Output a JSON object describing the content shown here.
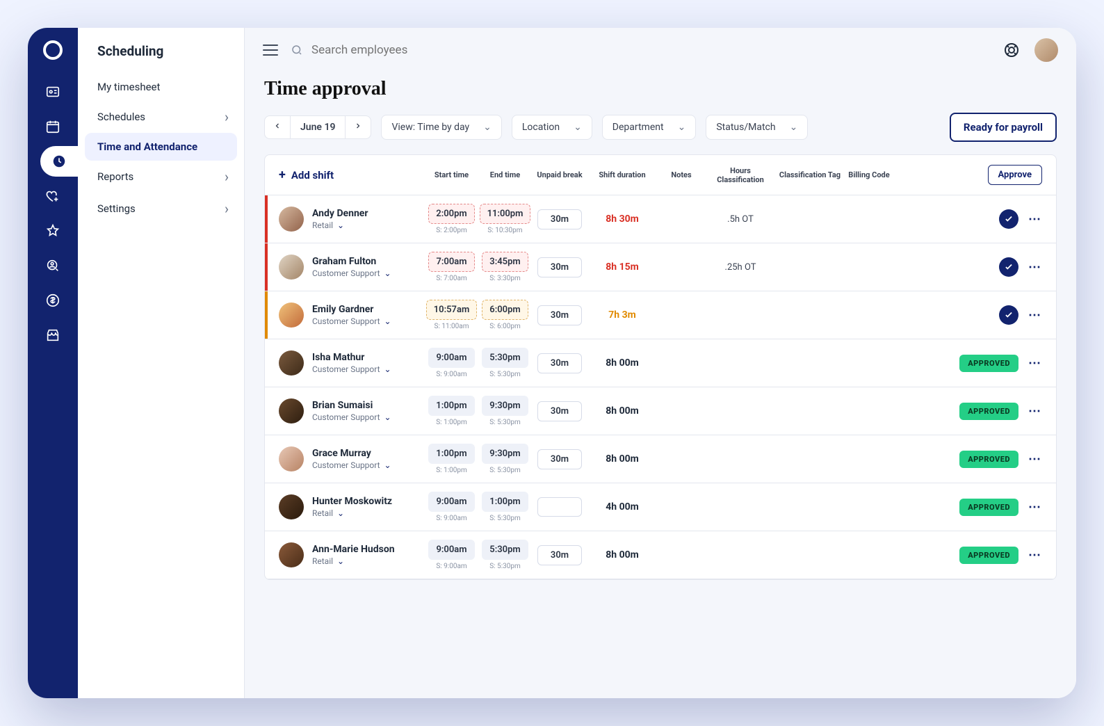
{
  "sidebar": {
    "title": "Scheduling",
    "items": [
      {
        "label": "My timesheet",
        "expandable": false
      },
      {
        "label": "Schedules",
        "expandable": true
      },
      {
        "label": "Time and Attendance",
        "expandable": false,
        "active": true
      },
      {
        "label": "Reports",
        "expandable": true
      },
      {
        "label": "Settings",
        "expandable": true
      }
    ]
  },
  "search": {
    "placeholder": "Search employees"
  },
  "page": {
    "title": "Time approval",
    "date": "June 19",
    "filters": {
      "view": "View: Time by day",
      "location": "Location",
      "department": "Department",
      "status": "Status/Match"
    },
    "payroll_btn": "Ready for payroll"
  },
  "table": {
    "add_shift_label": "Add shift",
    "headers": {
      "start": "Start time",
      "end": "End time",
      "break": "Unpaid break",
      "duration": "Shift duration",
      "notes": "Notes",
      "hours_class": "Hours Classification",
      "class_tag": "Classification Tag",
      "bill": "Billing Code",
      "approve": "Approve"
    },
    "rows": [
      {
        "name": "Andy Denner",
        "dept": "Retail",
        "start": "2:00pm",
        "start_sched": "S: 2:00pm",
        "end": "11:00pm",
        "end_sched": "S: 10:30pm",
        "break": "30m",
        "duration": "8h 30m",
        "dur_tone": "red",
        "hours_class": ".5h OT",
        "status": "pending",
        "tone": "red",
        "av": "linear-gradient(135deg,#d6b9a0,#92624a)"
      },
      {
        "name": "Graham Fulton",
        "dept": "Customer Support",
        "start": "7:00am",
        "start_sched": "S: 7:00am",
        "end": "3:45pm",
        "end_sched": "S: 3:30pm",
        "break": "30m",
        "duration": "8h 15m",
        "dur_tone": "red",
        "hours_class": ".25h OT",
        "status": "pending",
        "tone": "red",
        "av": "linear-gradient(135deg,#e0d4c4,#a38567)"
      },
      {
        "name": "Emily Gardner",
        "dept": "Customer Support",
        "start": "10:57am",
        "start_sched": "S: 11:00am",
        "end": "6:00pm",
        "end_sched": "S: 6:00pm",
        "break": "30m",
        "duration": "7h 3m",
        "dur_tone": "amber",
        "hours_class": "",
        "status": "pending",
        "tone": "amber",
        "av": "linear-gradient(135deg,#f0c27b,#c26a3a)"
      },
      {
        "name": "Isha Mathur",
        "dept": "Customer Support",
        "start": "9:00am",
        "start_sched": "S: 9:00am",
        "end": "5:30pm",
        "end_sched": "S: 5:30pm",
        "break": "30m",
        "duration": "8h 00m",
        "dur_tone": "default",
        "hours_class": "",
        "status": "approved",
        "tone": "",
        "av": "linear-gradient(135deg,#7a5a3e,#3d2a18)"
      },
      {
        "name": "Brian Sumaisi",
        "dept": "Customer Support",
        "start": "1:00pm",
        "start_sched": "S: 1:00pm",
        "end": "9:30pm",
        "end_sched": "S: 5:30pm",
        "break": "30m",
        "duration": "8h 00m",
        "dur_tone": "default",
        "hours_class": "",
        "status": "approved",
        "tone": "",
        "av": "linear-gradient(135deg,#6a4a2e,#2d1d0f)"
      },
      {
        "name": "Grace Murray",
        "dept": "Customer Support",
        "start": "1:00pm",
        "start_sched": "S: 1:00pm",
        "end": "9:30pm",
        "end_sched": "S: 5:30pm",
        "break": "30m",
        "duration": "8h 00m",
        "dur_tone": "default",
        "hours_class": "",
        "status": "approved",
        "tone": "",
        "av": "linear-gradient(135deg,#e8c8b6,#b78263)"
      },
      {
        "name": "Hunter Moskowitz",
        "dept": "Retail",
        "start": "9:00am",
        "start_sched": "S: 9:00am",
        "end": "1:00pm",
        "end_sched": "S: 5:30pm",
        "break": "",
        "duration": "4h 00m",
        "dur_tone": "default",
        "hours_class": "",
        "status": "approved",
        "tone": "",
        "av": "linear-gradient(135deg,#5b3d26,#2a1a0c)"
      },
      {
        "name": "Ann-Marie Hudson",
        "dept": "Retail",
        "start": "9:00am",
        "start_sched": "S: 9:00am",
        "end": "5:30pm",
        "end_sched": "S: 5:30pm",
        "break": "30m",
        "duration": "8h 00m",
        "dur_tone": "default",
        "hours_class": "",
        "status": "approved",
        "tone": "",
        "av": "linear-gradient(135deg,#8a5a3a,#4a2d18)"
      }
    ],
    "approved_label": "APPROVED"
  }
}
